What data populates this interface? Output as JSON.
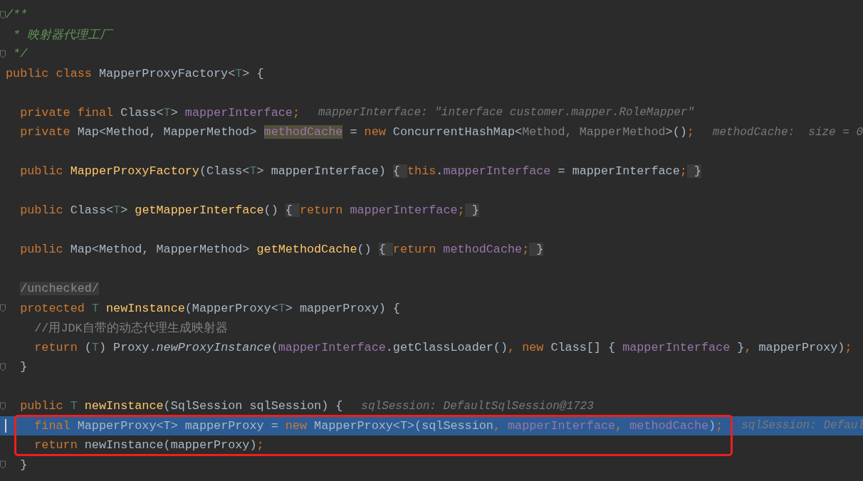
{
  "editor": {
    "lines": [
      {
        "fold": true,
        "highlighted": false,
        "tokens": [
          {
            "kind": "doc",
            "text": "/**"
          }
        ]
      },
      {
        "fold": false,
        "highlighted": false,
        "tokens": [
          {
            "kind": "doc",
            "text": " * 映射器代理工厂"
          }
        ]
      },
      {
        "fold": true,
        "highlighted": false,
        "tokens": [
          {
            "kind": "doc",
            "text": " */"
          }
        ]
      },
      {
        "fold": false,
        "highlighted": false,
        "tokens": [
          {
            "kind": "kw",
            "text": "public class "
          },
          {
            "kind": "plain",
            "text": "MapperProxyFactory<"
          },
          {
            "kind": "tparam",
            "text": "T"
          },
          {
            "kind": "plain",
            "text": "> {"
          }
        ],
        "children": [
          {
            "fold": false,
            "highlighted": false
          },
          {
            "fold": false,
            "highlighted": false,
            "tokens": [
              {
                "kind": "kw",
                "text": "private final "
              },
              {
                "kind": "plain",
                "text": "Class<"
              },
              {
                "kind": "tparam",
                "text": "T"
              },
              {
                "kind": "plain",
                "text": "> "
              },
              {
                "kind": "field",
                "text": "mapperInterface"
              },
              {
                "kind": "kw",
                "text": ";"
              }
            ],
            "hint": "mapperInterface: \"interface customer.mapper.RoleMapper\""
          },
          {
            "fold": false,
            "highlighted": false,
            "tokens": [
              {
                "kind": "kw",
                "text": "private "
              },
              {
                "kind": "plain",
                "text": "Map<Method, MapperMethod> "
              },
              {
                "kind": "mark",
                "text": "methodCache"
              },
              {
                "kind": "plain",
                "text": " = "
              },
              {
                "kind": "kw",
                "text": "new "
              },
              {
                "kind": "plain",
                "text": "ConcurrentHashMap<"
              },
              {
                "kind": "dim",
                "text": "Method, MapperMethod"
              },
              {
                "kind": "plain",
                "text": ">()"
              },
              {
                "kind": "kw",
                "text": ";"
              }
            ],
            "hint": "methodCache:  size = 0"
          },
          {
            "fold": false,
            "highlighted": false
          },
          {
            "fold": false,
            "highlighted": false,
            "tokens": [
              {
                "kind": "kw",
                "text": "public "
              },
              {
                "kind": "method",
                "text": "MapperProxyFactory"
              },
              {
                "kind": "plain",
                "text": "(Class<"
              },
              {
                "kind": "tparam",
                "text": "T"
              },
              {
                "kind": "plain",
                "text": "> mapperInterface) "
              },
              {
                "kind": "folded",
                "text": "{ "
              },
              {
                "kind": "kw",
                "text": "this"
              },
              {
                "kind": "plain",
                "text": "."
              },
              {
                "kind": "field",
                "text": "mapperInterface"
              },
              {
                "kind": "plain",
                "text": " = mapperInterface"
              },
              {
                "kind": "kw",
                "text": ";"
              },
              {
                "kind": "folded",
                "text": " }"
              }
            ]
          },
          {
            "fold": false,
            "highlighted": false
          },
          {
            "fold": false,
            "highlighted": false,
            "tokens": [
              {
                "kind": "kw",
                "text": "public "
              },
              {
                "kind": "plain",
                "text": "Class<"
              },
              {
                "kind": "tparam",
                "text": "T"
              },
              {
                "kind": "plain",
                "text": "> "
              },
              {
                "kind": "method",
                "text": "getMapperInterface"
              },
              {
                "kind": "plain",
                "text": "() "
              },
              {
                "kind": "folded",
                "text": "{ "
              },
              {
                "kind": "kw",
                "text": "return "
              },
              {
                "kind": "field",
                "text": "mapperInterface"
              },
              {
                "kind": "kw",
                "text": ";"
              },
              {
                "kind": "folded",
                "text": " }"
              }
            ]
          },
          {
            "fold": false,
            "highlighted": false
          },
          {
            "fold": false,
            "highlighted": false,
            "tokens": [
              {
                "kind": "kw",
                "text": "public "
              },
              {
                "kind": "plain",
                "text": "Map<Method, MapperMethod> "
              },
              {
                "kind": "method",
                "text": "getMethodCache"
              },
              {
                "kind": "plain",
                "text": "() "
              },
              {
                "kind": "folded",
                "text": "{ "
              },
              {
                "kind": "kw",
                "text": "return "
              },
              {
                "kind": "field",
                "text": "methodCache"
              },
              {
                "kind": "kw",
                "text": ";"
              },
              {
                "kind": "folded",
                "text": " }"
              }
            ]
          },
          {
            "fold": false,
            "highlighted": false
          },
          {
            "fold": false,
            "highlighted": false,
            "tokens": [
              {
                "kind": "annot",
                "text": "/unchecked/"
              }
            ]
          },
          {
            "fold": true,
            "highlighted": false,
            "tokens": [
              {
                "kind": "kw",
                "text": "protected "
              },
              {
                "kind": "tparam",
                "text": "T "
              },
              {
                "kind": "method",
                "text": "newInstance"
              },
              {
                "kind": "plain",
                "text": "(MapperProxy<"
              },
              {
                "kind": "tparam",
                "text": "T"
              },
              {
                "kind": "plain",
                "text": "> mapperProxy) {"
              }
            ],
            "children": [
              {
                "fold": false,
                "highlighted": false,
                "tokens": [
                  {
                    "kind": "comment",
                    "text": "//用JDK自带的动态代理生成映射器"
                  }
                ]
              },
              {
                "fold": false,
                "highlighted": false,
                "tokens": [
                  {
                    "kind": "kw",
                    "text": "return "
                  },
                  {
                    "kind": "plain",
                    "text": "("
                  },
                  {
                    "kind": "tparam",
                    "text": "T"
                  },
                  {
                    "kind": "plain",
                    "text": ") Proxy."
                  },
                  {
                    "kind": "italic",
                    "text": "newProxyInstance"
                  },
                  {
                    "kind": "plain",
                    "text": "("
                  },
                  {
                    "kind": "field",
                    "text": "mapperInterface"
                  },
                  {
                    "kind": "plain",
                    "text": ".getClassLoader()"
                  },
                  {
                    "kind": "kw",
                    "text": ", new "
                  },
                  {
                    "kind": "plain",
                    "text": "Class[] { "
                  },
                  {
                    "kind": "field",
                    "text": "mapperInterface"
                  },
                  {
                    "kind": "plain",
                    "text": " }"
                  },
                  {
                    "kind": "kw",
                    "text": ", "
                  },
                  {
                    "kind": "plain",
                    "text": "mapperProxy)"
                  },
                  {
                    "kind": "kw",
                    "text": ";"
                  }
                ]
              }
            ]
          },
          {
            "fold": true,
            "highlighted": false,
            "tokens": [
              {
                "kind": "plain",
                "text": "}"
              }
            ]
          },
          {
            "fold": false,
            "highlighted": false
          },
          {
            "fold": true,
            "highlighted": false,
            "tokens": [
              {
                "kind": "kw",
                "text": "public "
              },
              {
                "kind": "tparam",
                "text": "T "
              },
              {
                "kind": "method",
                "text": "newInstance"
              },
              {
                "kind": "plain",
                "text": "(SqlSession sqlSession) {"
              }
            ],
            "hint": "sqlSession: DefaultSqlSession@1723",
            "children": [
              {
                "fold": false,
                "highlighted": true,
                "tokens": [
                  {
                    "kind": "kw",
                    "text": "final "
                  },
                  {
                    "kind": "plain",
                    "text": "MapperProxy<"
                  },
                  {
                    "kind": "tparam",
                    "text": "T"
                  },
                  {
                    "kind": "plain",
                    "text": "> mapperProxy = "
                  },
                  {
                    "kind": "kw",
                    "text": "new "
                  },
                  {
                    "kind": "plain",
                    "text": "MapperProxy<"
                  },
                  {
                    "kind": "tparam",
                    "text": "T"
                  },
                  {
                    "kind": "plain",
                    "text": ">(sqlSession"
                  },
                  {
                    "kind": "kw",
                    "text": ", "
                  },
                  {
                    "kind": "field",
                    "text": "mapperInterface"
                  },
                  {
                    "kind": "kw",
                    "text": ", "
                  },
                  {
                    "kind": "field",
                    "text": "methodCache"
                  },
                  {
                    "kind": "plain",
                    "text": ")"
                  },
                  {
                    "kind": "kw",
                    "text": ";"
                  }
                ],
                "hint": "sqlSession: Defaul"
              },
              {
                "fold": false,
                "highlighted": false,
                "tokens": [
                  {
                    "kind": "kw",
                    "text": "return "
                  },
                  {
                    "kind": "plain",
                    "text": "newInstance(mapperProxy)"
                  },
                  {
                    "kind": "kw",
                    "text": ";"
                  }
                ]
              }
            ]
          },
          {
            "fold": true,
            "highlighted": false,
            "tokens": [
              {
                "kind": "plain",
                "text": "}"
              }
            ]
          }
        ]
      }
    ]
  }
}
